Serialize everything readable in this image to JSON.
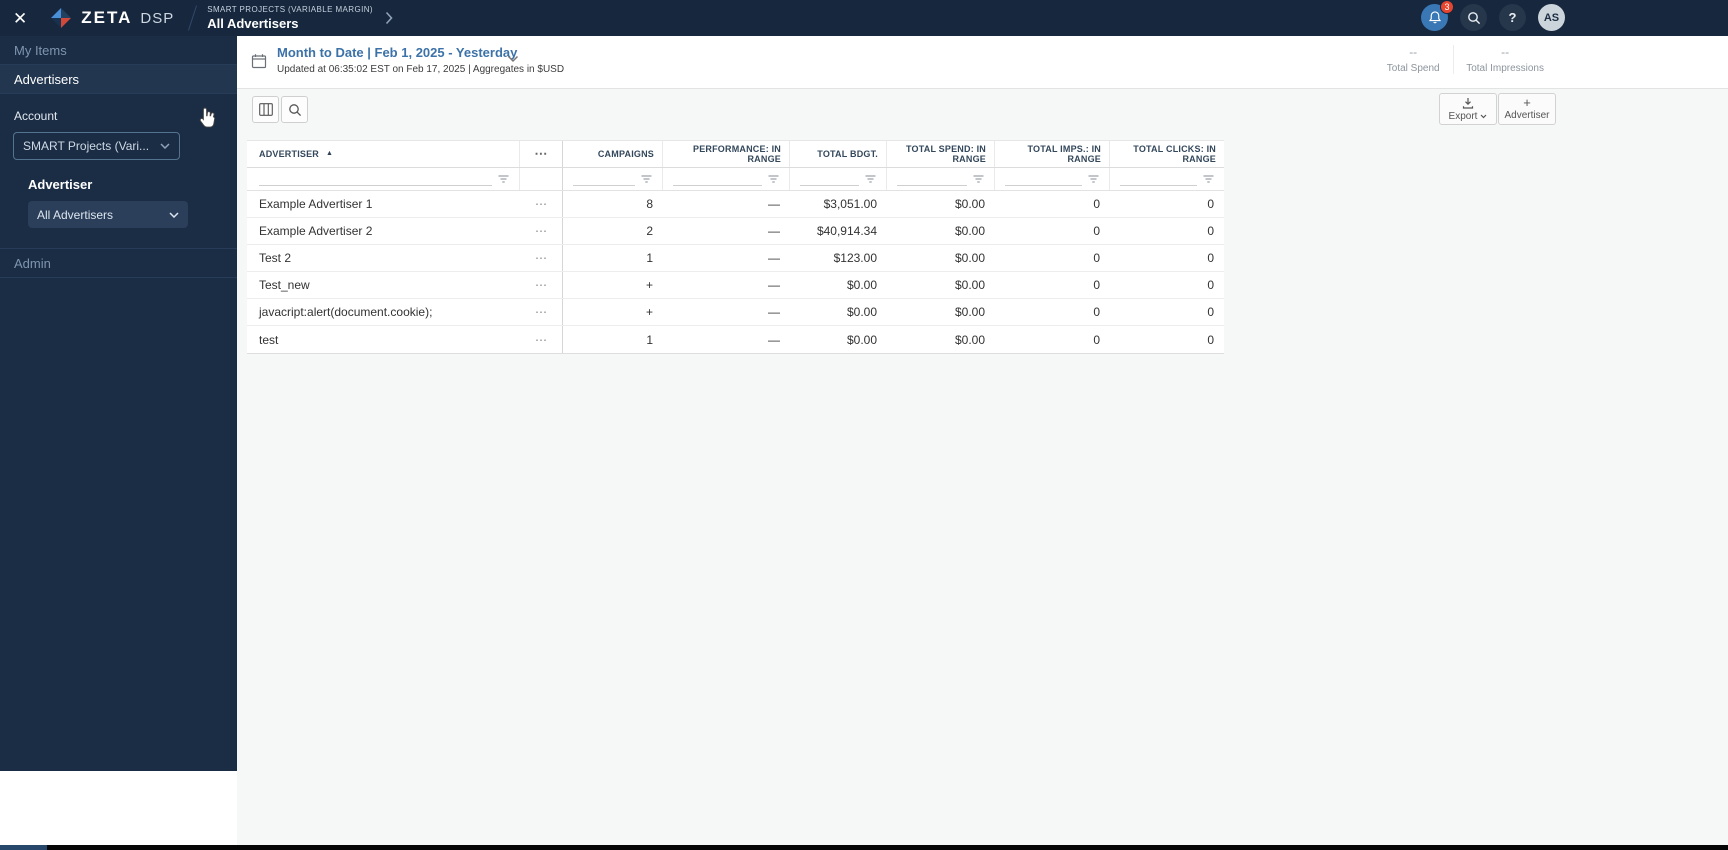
{
  "icons": {
    "close": "✕",
    "overflow": "⋯",
    "sort_asc": "▲",
    "plus": "+",
    "help": "?"
  },
  "colors": {
    "navy_bar": "#16273e",
    "sidebar_navy": "#1b2d45",
    "accent_blue": "#3a77b5",
    "link_blue": "#3c72a8",
    "badge_red": "#e8452e",
    "main_bg": "#f6f7f7"
  },
  "topbar": {
    "brand_primary": "ZETA",
    "brand_secondary": "DSP",
    "breadcrumb_parent": "SMART PROJECTS (VARIABLE MARGIN)",
    "breadcrumb_current": "All Advertisers",
    "notification_badge": "3",
    "avatar_initials": "AS"
  },
  "sidebar": {
    "my_items": "My Items",
    "advertisers": "Advertisers",
    "account_label": "Account",
    "account_value": "SMART Projects (Vari...",
    "advertiser_label": "Advertiser",
    "advertiser_value": "All Advertisers",
    "admin": "Admin"
  },
  "header": {
    "date_range": "Month to Date | Feb 1, 2025 - Yesterday",
    "updated": "Updated at 06:35:02 EST on Feb 17, 2025 | Aggregates in $USD",
    "total_spend_value": "--",
    "total_spend_label": "Total Spend",
    "total_impressions_value": "--",
    "total_impressions_label": "Total Impressions"
  },
  "toolbar": {
    "export_label": "Export",
    "advertiser_label": "Advertiser"
  },
  "table": {
    "headers": {
      "advertiser": "ADVERTISER",
      "campaigns": "CAMPAIGNS",
      "performance": "PERFORMANCE: IN RANGE",
      "total_budget": "TOTAL BDGT.",
      "total_spend": "TOTAL SPEND: IN RANGE",
      "total_imps": "TOTAL IMPS.: IN RANGE",
      "total_clicks": "TOTAL CLICKS: IN RANGE"
    },
    "rows": [
      {
        "advertiser": "Example Advertiser 1",
        "campaigns": "8",
        "performance": "—",
        "total_budget": "$3,051.00",
        "total_spend": "$0.00",
        "total_imps": "0",
        "total_clicks": "0"
      },
      {
        "advertiser": "Example Advertiser 2",
        "campaigns": "2",
        "performance": "—",
        "total_budget": "$40,914.34",
        "total_spend": "$0.00",
        "total_imps": "0",
        "total_clicks": "0"
      },
      {
        "advertiser": "Test 2",
        "campaigns": "1",
        "performance": "—",
        "total_budget": "$123.00",
        "total_spend": "$0.00",
        "total_imps": "0",
        "total_clicks": "0"
      },
      {
        "advertiser": "Test_new",
        "campaigns": "+",
        "performance": "—",
        "total_budget": "$0.00",
        "total_spend": "$0.00",
        "total_imps": "0",
        "total_clicks": "0"
      },
      {
        "advertiser": "javacript:alert(document.cookie);",
        "campaigns": "+",
        "performance": "—",
        "total_budget": "$0.00",
        "total_spend": "$0.00",
        "total_imps": "0",
        "total_clicks": "0"
      },
      {
        "advertiser": "test",
        "campaigns": "1",
        "performance": "—",
        "total_budget": "$0.00",
        "total_spend": "$0.00",
        "total_imps": "0",
        "total_clicks": "0"
      }
    ]
  }
}
